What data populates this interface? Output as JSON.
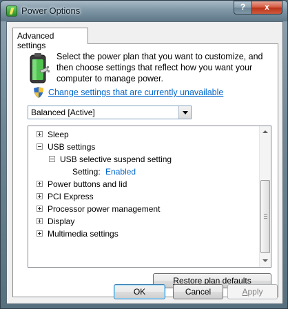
{
  "window": {
    "title": "Power Options"
  },
  "titlebar_buttons": {
    "help": "?",
    "close": "x"
  },
  "tabs": [
    {
      "label": "Advanced settings"
    }
  ],
  "intro": {
    "text": "Select the power plan that you want to customize, and then choose settings that reflect how you want your computer to manage power."
  },
  "change_link": "Change settings that are currently unavailable",
  "plan_select": {
    "selected": "Balanced [Active]"
  },
  "tree": {
    "items": [
      {
        "label": "Sleep",
        "expanded": false
      },
      {
        "label": "USB settings",
        "expanded": true
      },
      {
        "label": "USB selective suspend setting",
        "expanded": true
      },
      {
        "label": "Setting:",
        "value": "Enabled"
      },
      {
        "label": "Power buttons and lid",
        "expanded": false
      },
      {
        "label": "PCI Express",
        "expanded": false
      },
      {
        "label": "Processor power management",
        "expanded": false
      },
      {
        "label": "Display",
        "expanded": false
      },
      {
        "label": "Multimedia settings",
        "expanded": false
      }
    ]
  },
  "buttons": {
    "restore_first": "R",
    "restore_rest": "estore plan defaults",
    "ok": "OK",
    "cancel": "Cancel",
    "apply_first": "A",
    "apply_rest": "pply"
  }
}
